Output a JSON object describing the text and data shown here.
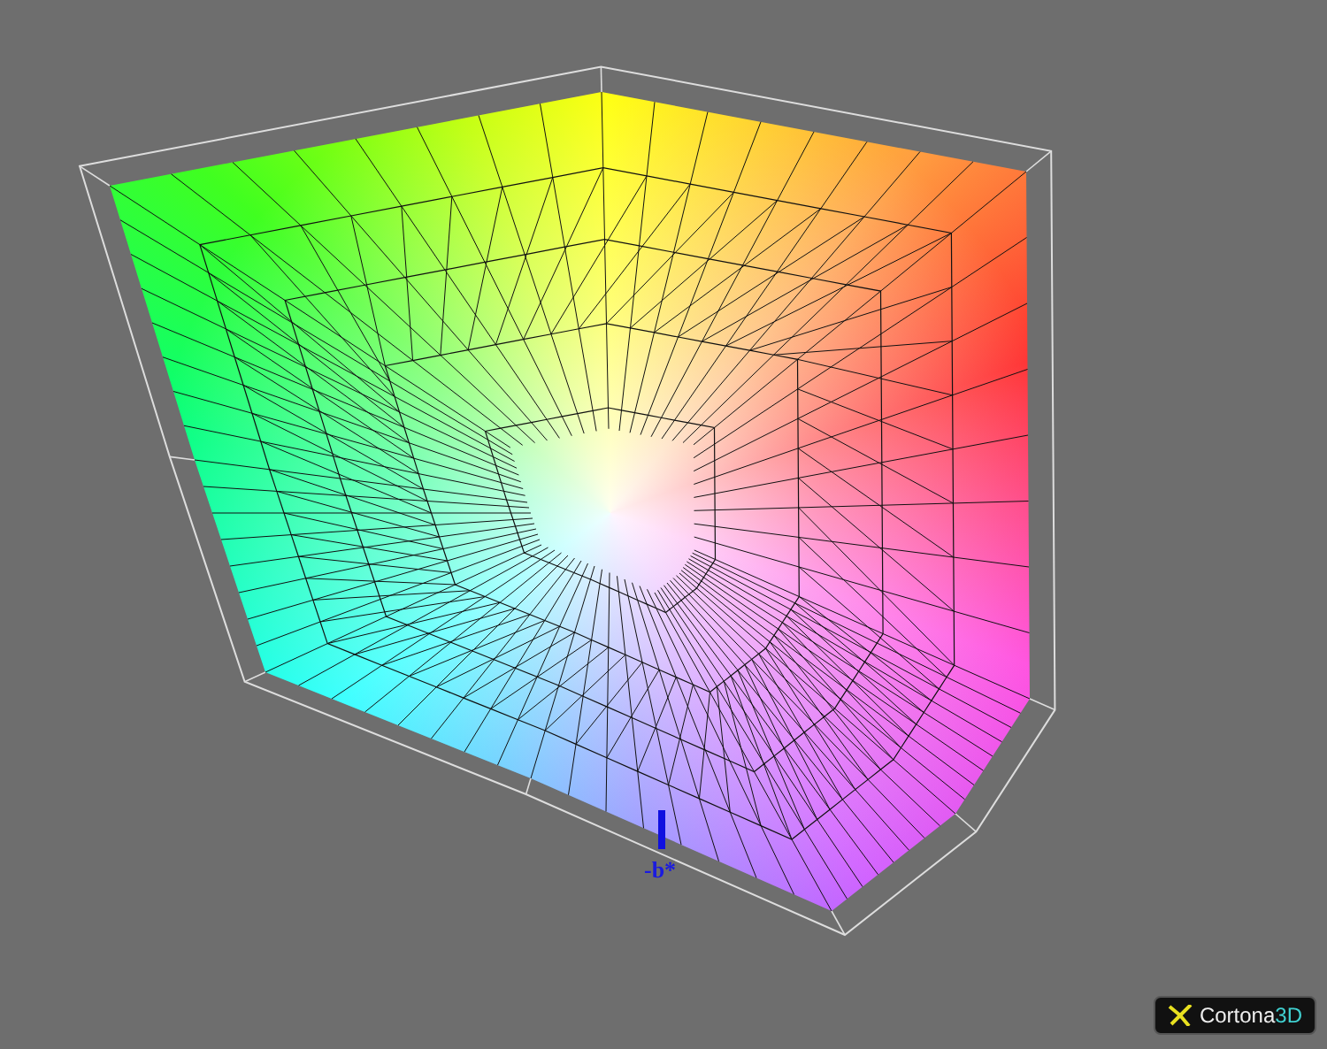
{
  "viewer": {
    "axis_label": {
      "text": "-b*"
    },
    "logo": {
      "name": "Cortona",
      "suffix": "3D"
    }
  }
}
